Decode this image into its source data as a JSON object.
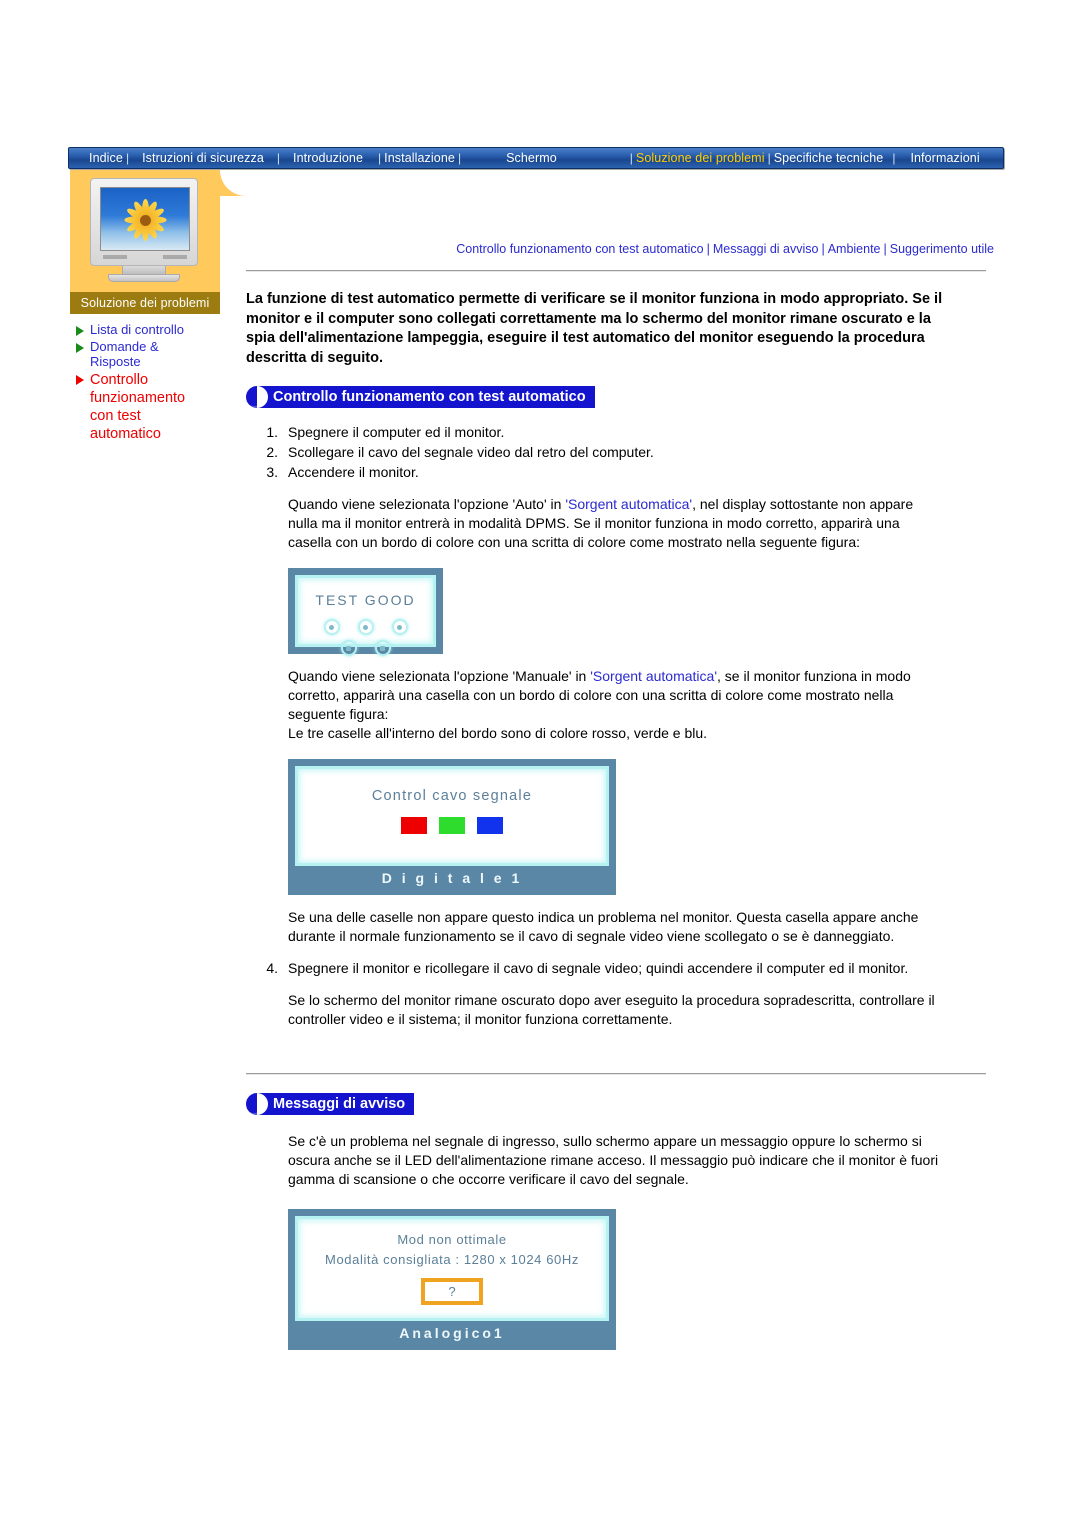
{
  "topnav": {
    "items": [
      {
        "label": "Indice",
        "active": false
      },
      {
        "label": "Istruzioni di sicurezza",
        "active": false
      },
      {
        "label": "Introduzione",
        "active": false
      },
      {
        "label": "Installazione",
        "active": false
      },
      {
        "label": "Schermo",
        "active": false
      },
      {
        "label": "Soluzione dei problemi",
        "active": true
      },
      {
        "label": "Specifiche tecniche",
        "active": false
      },
      {
        "label": "Informazioni",
        "active": false
      }
    ]
  },
  "sidebar": {
    "thumb_caption": "Soluzione dei problemi",
    "items": [
      {
        "label": "Lista di controllo",
        "current": false
      },
      {
        "label": "Domande & Risposte",
        "current": false
      },
      {
        "label": "Controllo funzionamento con test automatico",
        "current": true
      }
    ]
  },
  "content": {
    "toplinks": [
      "Controllo funzionamento con test automatico",
      "Messaggi di avviso",
      "Ambiente",
      "Suggerimento utile"
    ],
    "lead": "La funzione di test automatico permette di verificare se il monitor funziona in modo appropriato. Se il monitor e il computer sono collegati correttamente ma lo schermo del monitor rimane oscurato e la spia dell'alimentazione lampeggia, eseguire il test automatico del monitor eseguendo la procedura descritta di seguito.",
    "section1_title": "Controllo funzionamento con test automatico",
    "steps": [
      {
        "num": "1.",
        "text": "Spegnere il computer ed il monitor."
      },
      {
        "num": "2.",
        "text": "Scollegare il cavo del segnale video dal retro del computer."
      },
      {
        "num": "3.",
        "text": "Accendere il monitor."
      }
    ],
    "para_auto_a": "Quando viene selezionata l'opzione 'Auto' in ",
    "para_auto_link": "'Sorgent automatica'",
    "para_auto_b": ", nel display sottostante non appare nulla ma il monitor entrerà in modalità DPMS. Se il monitor funziona in modo corretto, apparirà una casella con un bordo di colore con una scritta di colore come mostrato nella seguente figura:",
    "para_manual_a": "Quando viene selezionata l'opzione 'Manuale' in ",
    "para_manual_link": "'Sorgent automatica'",
    "para_manual_b": ", se il monitor funziona in modo corretto, apparirà una casella con un bordo di colore con una scritta di colore come mostrato nella seguente figura:",
    "para_manual_c": "Le tre caselle all'interno del bordo sono di colore rosso, verde e blu.",
    "para_missing": "Se una delle caselle non appare questo indica un problema nel monitor. Questa casella appare anche durante il normale funzionamento se il cavo di segnale video viene scollegato o se è danneggiato.",
    "step4_num": "4.",
    "step4_text": "Spegnere il monitor e ricollegare il cavo di segnale video; quindi accendere il computer ed il monitor.",
    "para_dark": "Se lo schermo del monitor rimane oscurato dopo aver eseguito la procedura sopradescritta, controllare il controller video e il sistema; il monitor funziona correttamente.",
    "section2_title": "Messaggi di avviso",
    "para_warning": "Se c'è un problema nel segnale di ingresso, sullo schermo appare un messaggio oppure lo schermo si oscura anche se il LED dell'alimentazione rimane acceso. Il messaggio può indicare che il monitor è fuori gamma di scansione o che occorre verificare il cavo del segnale."
  },
  "figures": {
    "test_good": {
      "title": "TEST  GOOD"
    },
    "cable_check": {
      "title": "Control cavo segnale",
      "footer": "D i g i t a l e 1",
      "swatch_colors": [
        "#ee0000",
        "#2ddc2d",
        "#1133ee"
      ]
    },
    "warning_osd": {
      "line1": "Mod non ottimale",
      "line2": "Modalità consigliata : 1280 x 1024  60Hz",
      "question": "?",
      "footer": "Analogico1"
    }
  },
  "colors": {
    "nav_bg": "#1e55a0",
    "nav_active": "#ffcc00",
    "link_blue": "#2a2ad0",
    "current_red": "#ee0000",
    "panel_yellow": "#ffc95b",
    "caption_brown": "#9c7b10",
    "section_blue": "#1414cf",
    "osd_frame": "#5b87a6",
    "osd_glow": "#b6f2f2",
    "osd_text": "#5b7f99",
    "qbox_orange": "#efa321"
  }
}
